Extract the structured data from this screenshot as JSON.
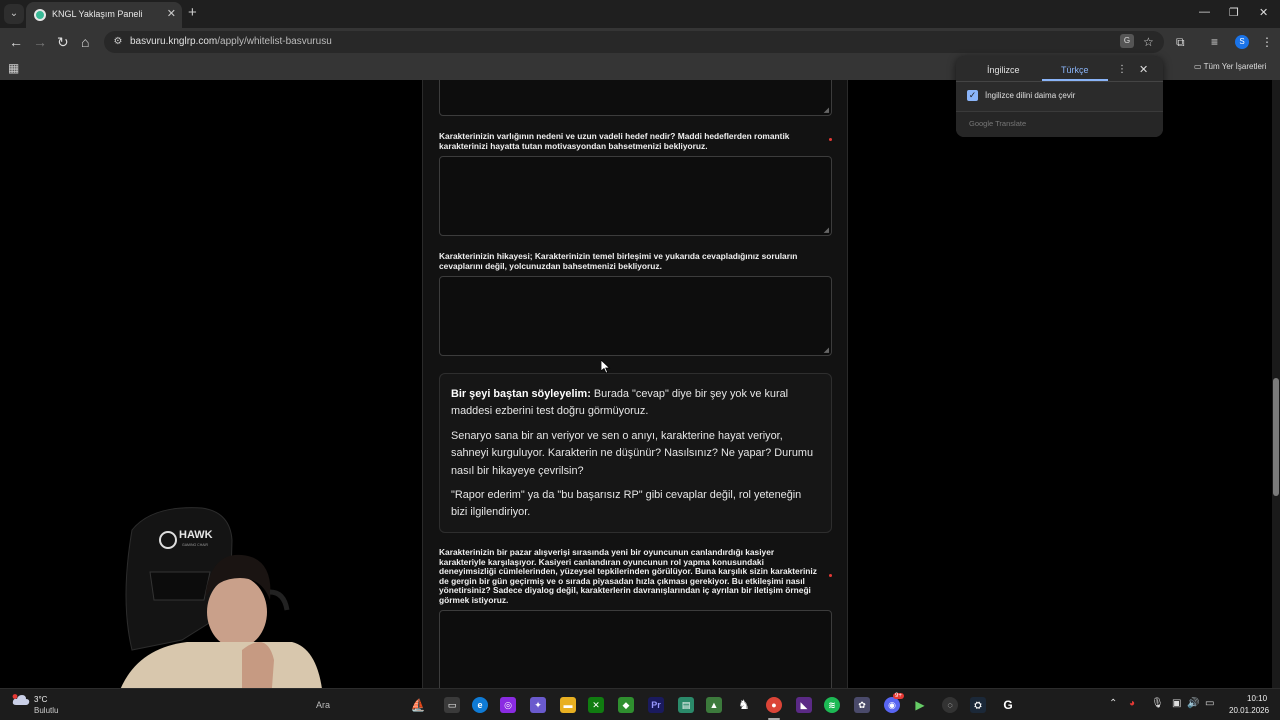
{
  "browser": {
    "tab_title": "KNGL Yaklaşım Paneli",
    "url_host": "basvuru.knglrp.com",
    "url_path": "/apply/whitelist-basvurusu",
    "profile_initial": "S",
    "bookmarks_all_label": "Tüm Yer İşaretleri"
  },
  "translate_popup": {
    "source_language": "İngilizce",
    "target_language": "Türkçe",
    "always_translate_label": "İngilizce dilini daima çevir",
    "always_translate_checked": true,
    "footer": "Google Translate"
  },
  "form": {
    "question_motivation": "Karakterinizin varlığının nedeni ve uzun vadeli hedef nedir? Maddi hedeflerden romantik karakterinizi hayatta tutan motivasyondan bahsetmenizi bekliyoruz.",
    "question_story": "Karakterinizin hikayesi; Karakterinizin temel birleşimi ve yukarıda cevapladığınız soruların cevaplarını değil, yolcunuzdan bahsetmenizi bekliyoruz.",
    "info_bold": "Bir şeyi baştan söyleyelim:",
    "info_p1": " Burada \"cevap\" diye bir şey yok ve kural maddesi ezberini test doğru görmüyoruz.",
    "info_p2": "Senaryo sana bir an veriyor ve sen o anıyı, karakterine hayat veriyor, sahneyi kurguluyor. Karakterin ne düşünür? Nasılsınız? Ne yapar? Durumu nasıl bir hikayeye çevrilsin?",
    "info_p3": "\"Rapor ederim\" ya da \"bu başarısız RP\" gibi cevaplar değil, rol yeteneğin bizi ilgilendiriyor.",
    "question_market": "Karakterinizin bir pazar alışverişi sırasında yeni bir oyuncunun canlandırdığı kasiyer karakteriyle karşılaşıyor. Kasiyeri canlandıran oyuncunun rol yapma konusundaki deneyimsizliği cümlelerinden, yüzeysel tepkilerinden görülüyor. Buna karşılık sizin karakteriniz de gergin bir gün geçirmiş ve o sırada piyasadan hızla çıkması gerekiyor. Bu etkileşimi nasıl yönetirsiniz? Sadece diyalog değil, karakterlerin davranışlarından iç ayrılan bir iletişim örneği görmek istiyoruz."
  },
  "webcam": {
    "chair_brand": "HAWK",
    "chair_sub": "GAMING CHAIR"
  },
  "taskbar": {
    "temperature": "3°C",
    "weather": "Bulutlu",
    "search_label": "Ara",
    "time": "10:10",
    "date": "20.01.2026",
    "discord_badge": "9+"
  },
  "colors": {
    "accent_blue": "#8ab4f8",
    "required_red": "#e53935",
    "panel_bg": "#121212"
  }
}
